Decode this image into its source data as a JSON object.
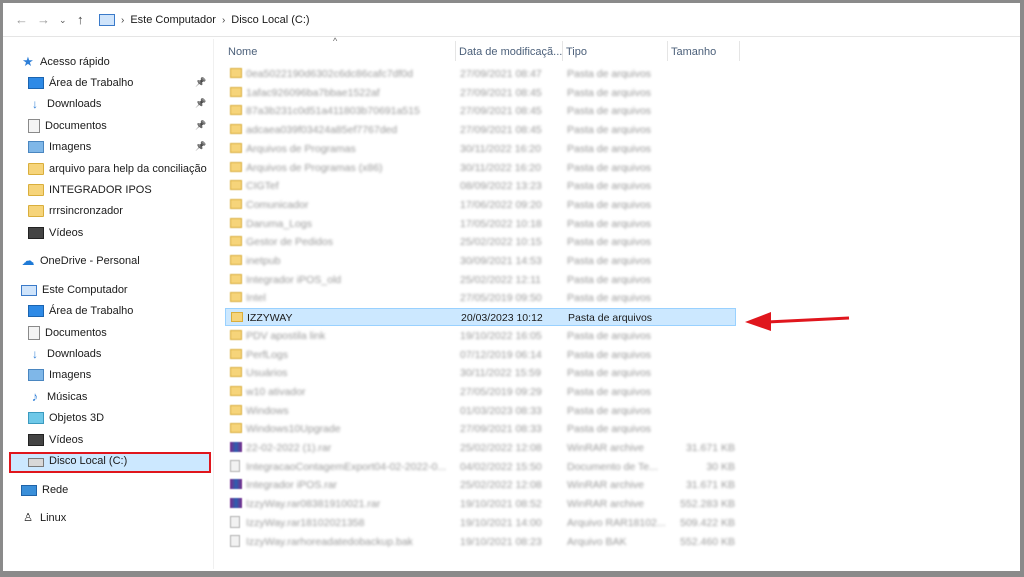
{
  "breadcrumb": [
    "Este Computador",
    "Disco Local (C:)"
  ],
  "sidebar": {
    "items": [
      {
        "label": "Acesso rápido",
        "icon": "star-icon",
        "pinned": false,
        "indent": 0
      },
      {
        "label": "Área de Trabalho",
        "icon": "desktop-icon",
        "pinned": true,
        "indent": 1
      },
      {
        "label": "Downloads",
        "icon": "download-icon",
        "pinned": true,
        "indent": 1
      },
      {
        "label": "Documentos",
        "icon": "document-icon",
        "pinned": true,
        "indent": 1
      },
      {
        "label": "Imagens",
        "icon": "images-icon",
        "pinned": true,
        "indent": 1
      },
      {
        "label": "arquivo para help da conciliação f",
        "icon": "folder-icon",
        "pinned": false,
        "indent": 1
      },
      {
        "label": "INTEGRADOR IPOS",
        "icon": "folder-icon",
        "pinned": false,
        "indent": 1
      },
      {
        "label": "rrrsincronzador",
        "icon": "folder-icon",
        "pinned": false,
        "indent": 1
      },
      {
        "label": "Vídeos",
        "icon": "videos-icon",
        "pinned": false,
        "indent": 1
      },
      {
        "label": "OneDrive - Personal",
        "icon": "cloud-icon",
        "pinned": false,
        "indent": 0
      },
      {
        "label": "Este Computador",
        "icon": "computer-icon",
        "pinned": false,
        "indent": 0
      },
      {
        "label": "Área de Trabalho",
        "icon": "desktop-icon",
        "pinned": false,
        "indent": 1
      },
      {
        "label": "Documentos",
        "icon": "document-icon",
        "pinned": false,
        "indent": 1
      },
      {
        "label": "Downloads",
        "icon": "download-icon",
        "pinned": false,
        "indent": 1
      },
      {
        "label": "Imagens",
        "icon": "images-icon",
        "pinned": false,
        "indent": 1
      },
      {
        "label": "Músicas",
        "icon": "music-icon",
        "pinned": false,
        "indent": 1
      },
      {
        "label": "Objetos 3D",
        "icon": "objects-3d-icon",
        "pinned": false,
        "indent": 1
      },
      {
        "label": "Vídeos",
        "icon": "videos-icon",
        "pinned": false,
        "indent": 1
      },
      {
        "label": "Disco Local (C:)",
        "icon": "drive-icon",
        "pinned": false,
        "indent": 1
      },
      {
        "label": "Rede",
        "icon": "network-icon",
        "pinned": false,
        "indent": 0
      },
      {
        "label": "Linux",
        "icon": "linux-icon",
        "pinned": false,
        "indent": 0
      }
    ]
  },
  "columns": {
    "name": "Nome",
    "date": "Data de modificaçã...",
    "type": "Tipo",
    "size": "Tamanho"
  },
  "files": [
    {
      "name": "0ea5022190d6302c6dc86cafc7df0d",
      "date": "27/09/2021 08:47",
      "type": "Pasta de arquivos",
      "size": "",
      "icon": "folder",
      "blurred": true
    },
    {
      "name": "1afac926096ba7bbae1522af",
      "date": "27/09/2021 08:45",
      "type": "Pasta de arquivos",
      "size": "",
      "icon": "folder",
      "blurred": true
    },
    {
      "name": "87a3b231c0d51a411803b70691a515",
      "date": "27/09/2021 08:45",
      "type": "Pasta de arquivos",
      "size": "",
      "icon": "folder",
      "blurred": true
    },
    {
      "name": "adcaea039f03424a85ef7767ded",
      "date": "27/09/2021 08:45",
      "type": "Pasta de arquivos",
      "size": "",
      "icon": "folder",
      "blurred": true
    },
    {
      "name": "Arquivos de Programas",
      "date": "30/11/2022 16:20",
      "type": "Pasta de arquivos",
      "size": "",
      "icon": "folder",
      "blurred": true
    },
    {
      "name": "Arquivos de Programas (x86)",
      "date": "30/11/2022 16:20",
      "type": "Pasta de arquivos",
      "size": "",
      "icon": "folder",
      "blurred": true
    },
    {
      "name": "CIGTef",
      "date": "08/09/2022 13:23",
      "type": "Pasta de arquivos",
      "size": "",
      "icon": "folder",
      "blurred": true
    },
    {
      "name": "Comunicador",
      "date": "17/06/2022 09:20",
      "type": "Pasta de arquivos",
      "size": "",
      "icon": "folder",
      "blurred": true
    },
    {
      "name": "Daruma_Logs",
      "date": "17/05/2022 10:18",
      "type": "Pasta de arquivos",
      "size": "",
      "icon": "folder",
      "blurred": true
    },
    {
      "name": "Gestor de Pedidos",
      "date": "25/02/2022 10:15",
      "type": "Pasta de arquivos",
      "size": "",
      "icon": "folder",
      "blurred": true
    },
    {
      "name": "inetpub",
      "date": "30/09/2021 14:53",
      "type": "Pasta de arquivos",
      "size": "",
      "icon": "folder",
      "blurred": true
    },
    {
      "name": "Integrador iPOS_old",
      "date": "25/02/2022 12:11",
      "type": "Pasta de arquivos",
      "size": "",
      "icon": "folder",
      "blurred": true
    },
    {
      "name": "Intel",
      "date": "27/05/2019 09:50",
      "type": "Pasta de arquivos",
      "size": "",
      "icon": "folder",
      "blurred": true
    },
    {
      "name": "IZZYWAY",
      "date": "20/03/2023 10:12",
      "type": "Pasta de arquivos",
      "size": "",
      "icon": "folder",
      "blurred": false,
      "selected": true
    },
    {
      "name": "PDV apostila link",
      "date": "19/10/2022 16:05",
      "type": "Pasta de arquivos",
      "size": "",
      "icon": "folder",
      "blurred": true
    },
    {
      "name": "PerfLogs",
      "date": "07/12/2019 06:14",
      "type": "Pasta de arquivos",
      "size": "",
      "icon": "folder",
      "blurred": true
    },
    {
      "name": "Usuários",
      "date": "30/11/2022 15:59",
      "type": "Pasta de arquivos",
      "size": "",
      "icon": "folder",
      "blurred": true
    },
    {
      "name": "w10 ativador",
      "date": "27/05/2019 09:29",
      "type": "Pasta de arquivos",
      "size": "",
      "icon": "folder",
      "blurred": true
    },
    {
      "name": "Windows",
      "date": "01/03/2023 08:33",
      "type": "Pasta de arquivos",
      "size": "",
      "icon": "folder",
      "blurred": true
    },
    {
      "name": "Windows10Upgrade",
      "date": "27/09/2021 08:33",
      "type": "Pasta de arquivos",
      "size": "",
      "icon": "folder",
      "blurred": true
    },
    {
      "name": "22-02-2022 (1).rar",
      "date": "25/02/2022 12:08",
      "type": "WinRAR archive",
      "size": "31.671 KB",
      "icon": "rar",
      "blurred": true
    },
    {
      "name": "IntegracaoContagemExport04-02-2022-0...",
      "date": "04/02/2022 15:50",
      "type": "Documento de Te...",
      "size": "30 KB",
      "icon": "file",
      "blurred": true
    },
    {
      "name": "Integrador iPOS.rar",
      "date": "25/02/2022 12:08",
      "type": "WinRAR archive",
      "size": "31.671 KB",
      "icon": "rar",
      "blurred": true
    },
    {
      "name": "IzzyWay.rar08381910021.rar",
      "date": "19/10/2021 08:52",
      "type": "WinRAR archive",
      "size": "552.283 KB",
      "icon": "rar",
      "blurred": true
    },
    {
      "name": "IzzyWay.rar18102021358",
      "date": "19/10/2021 14:00",
      "type": "Arquivo RAR18102...",
      "size": "509.422 KB",
      "icon": "file",
      "blurred": true
    },
    {
      "name": "IzzyWay.rarhoreadatedobackup.bak",
      "date": "19/10/2021 08:23",
      "type": "Arquivo BAK",
      "size": "552.460 KB",
      "icon": "file",
      "blurred": true
    }
  ],
  "colors": {
    "selection": "#cce8ff",
    "selection_border": "#99d1ff",
    "highlight": "#e0161d",
    "arrow": "#e0161d",
    "folder": "#f6d47a"
  }
}
